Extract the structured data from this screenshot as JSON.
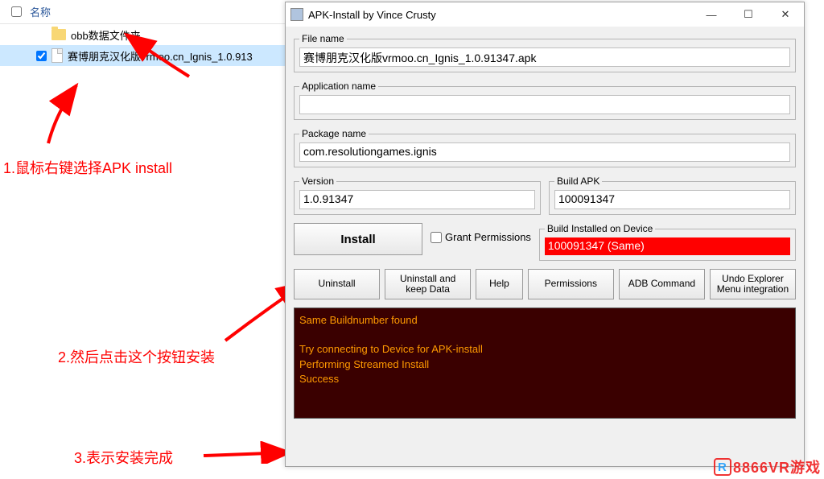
{
  "explorer": {
    "name_header": "名称",
    "items": [
      {
        "name": "obb数据文件夹"
      },
      {
        "name": "赛博朋克汉化版vrmoo.cn_Ignis_1.0.91347.apk",
        "display": "赛博朋克汉化版vrmoo.cn_Ignis_1.0.913"
      }
    ]
  },
  "annotations": {
    "step1": "1.鼠标右键选择APK install",
    "step2": "2.然后点击这个按钮安装",
    "step3": "3.表示安装完成"
  },
  "dialog": {
    "title": "APK-Install by Vince Crusty",
    "labels": {
      "file_name": "File name",
      "application_name": "Application name",
      "package_name": "Package name",
      "version": "Version",
      "build_apk": "Build APK",
      "build_installed": "Build Installed on Device"
    },
    "values": {
      "file_name": "赛博朋克汉化版vrmoo.cn_Ignis_1.0.91347.apk",
      "application_name": "",
      "package_name": "com.resolutiongames.ignis",
      "version": "1.0.91347",
      "build_apk": "100091347",
      "build_installed": "100091347 (Same)"
    },
    "buttons": {
      "install": "Install",
      "grant": "Grant Permissions",
      "uninstall": "Uninstall",
      "uninstall_keep": "Uninstall and keep Data",
      "help": "Help",
      "permissions": "Permissions",
      "adb": "ADB Command",
      "undo_explorer": "Undo Explorer Menu integration"
    },
    "console_lines": [
      "Same Buildnumber found",
      "",
      "Try connecting to Device for APK-install",
      "Performing Streamed Install",
      "Success"
    ]
  },
  "watermark": "8866VR游戏"
}
